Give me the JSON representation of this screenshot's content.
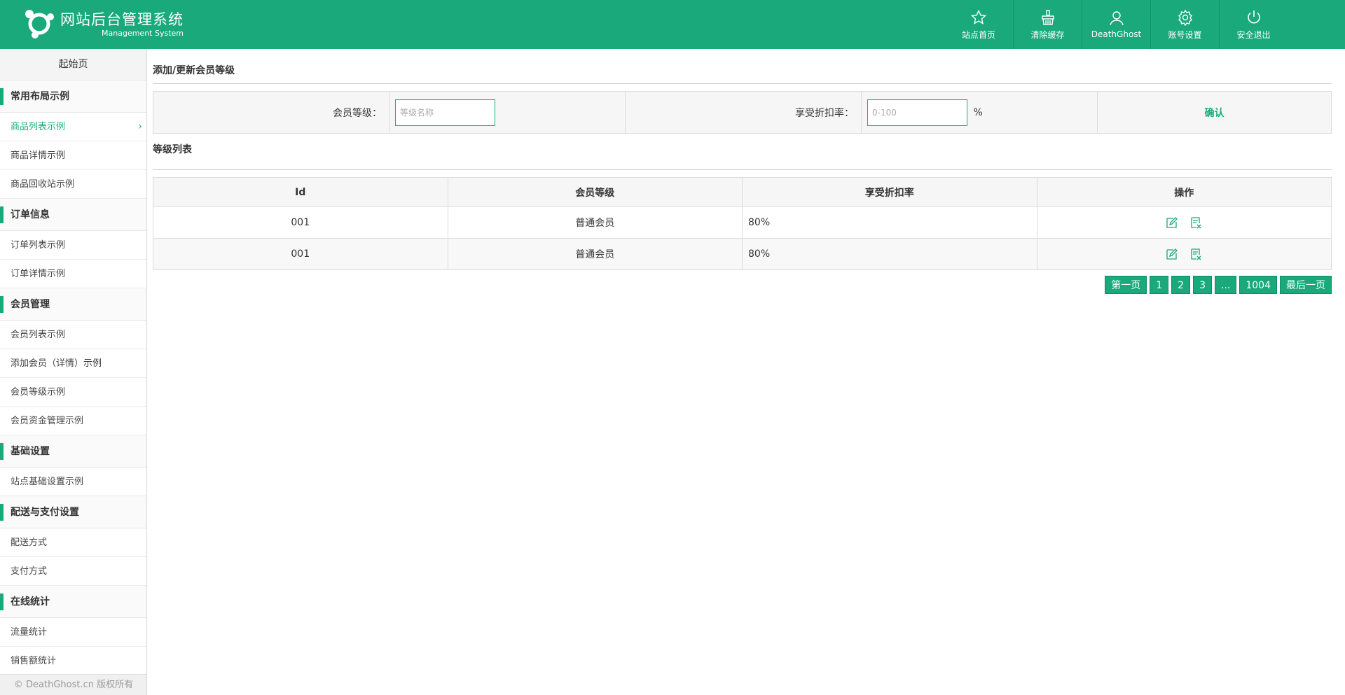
{
  "header": {
    "title": "网站后台管理系统",
    "subtitle": "Management System",
    "nav": [
      {
        "label": "站点首页",
        "icon": "star-icon"
      },
      {
        "label": "清除缓存",
        "icon": "broom-icon"
      },
      {
        "label": "DeathGhost",
        "icon": "user-icon"
      },
      {
        "label": "账号设置",
        "icon": "gear-icon"
      },
      {
        "label": "安全退出",
        "icon": "power-icon"
      }
    ]
  },
  "sidebar": {
    "home": "起始页",
    "groups": [
      {
        "title": "常用布局示例",
        "items": [
          "商品列表示例",
          "商品详情示例",
          "商品回收站示例"
        ]
      },
      {
        "title": "订单信息",
        "items": [
          "订单列表示例",
          "订单详情示例"
        ]
      },
      {
        "title": "会员管理",
        "items": [
          "会员列表示例",
          "添加会员（详情）示例",
          "会员等级示例",
          "会员资金管理示例"
        ]
      },
      {
        "title": "基础设置",
        "items": [
          "站点基础设置示例"
        ]
      },
      {
        "title": "配送与支付设置",
        "items": [
          "配送方式",
          "支付方式"
        ]
      },
      {
        "title": "在线统计",
        "items": [
          "流量统计",
          "销售额统计"
        ]
      }
    ],
    "active_item": "商品列表示例",
    "footer": "© DeathGhost.cn 版权所有"
  },
  "form": {
    "title": "添加/更新会员等级",
    "level_label": "会员等级：",
    "level_placeholder": "等级名称",
    "discount_label": "享受折扣率：",
    "discount_placeholder": "0-100",
    "percent": "%",
    "confirm": "确认"
  },
  "list": {
    "title": "等级列表",
    "columns": [
      "Id",
      "会员等级",
      "享受折扣率",
      "操作"
    ],
    "rows": [
      {
        "id": "001",
        "level": "普通会员",
        "discount": "80%"
      },
      {
        "id": "001",
        "level": "普通会员",
        "discount": "80%"
      }
    ]
  },
  "pager": [
    "第一页",
    "1",
    "2",
    "3",
    "...",
    "1004",
    "最后一页"
  ],
  "colors": {
    "accent": "#19a97b"
  }
}
